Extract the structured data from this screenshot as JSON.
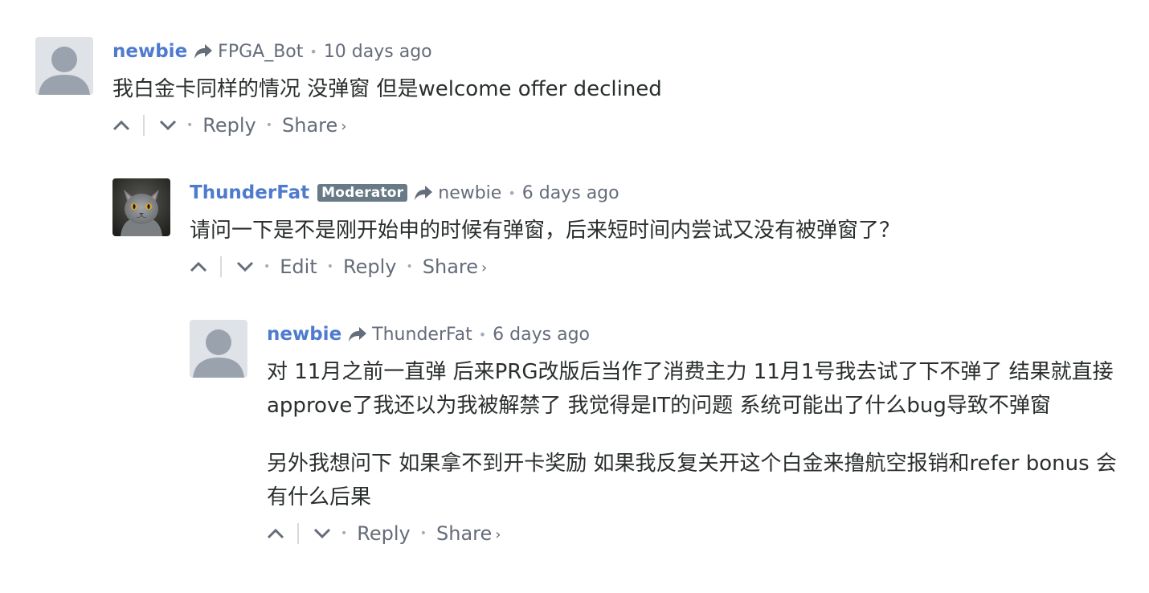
{
  "comments": [
    {
      "author": "newbie",
      "parent": "FPGA_Bot",
      "time": "10 days ago",
      "paragraphs": [
        "我白金卡同样的情况 没弹窗 但是welcome offer declined"
      ],
      "actions": {
        "reply": "Reply",
        "share": "Share"
      }
    },
    {
      "author": "ThunderFat",
      "badge": "Moderator",
      "parent": "newbie",
      "time": "6 days ago",
      "paragraphs": [
        "请问一下是不是刚开始申的时候有弹窗，后来短时间内尝试又没有被弹窗了？"
      ],
      "actions": {
        "edit": "Edit",
        "reply": "Reply",
        "share": "Share"
      }
    },
    {
      "author": "newbie",
      "parent": "ThunderFat",
      "time": "6 days ago",
      "paragraphs": [
        "对 11月之前一直弹 后来PRG改版后当作了消费主力 11月1号我去试了下不弹了 结果就直接approve了我还以为我被解禁了 我觉得是IT的问题 系统可能出了什么bug导致不弹窗",
        "另外我想问下 如果拿不到开卡奖励 如果我反复关开这个白金来撸航空报销和refer bonus 会有什么后果"
      ],
      "actions": {
        "reply": "Reply",
        "share": "Share"
      }
    }
  ],
  "separators": {
    "dot": "•",
    "chevron": "›"
  },
  "icons": {
    "reply_arrow": "reply-arrow-icon",
    "upvote": "chevron-up-icon",
    "downvote": "chevron-down-icon",
    "default_avatar": "user-silhouette-icon",
    "cat_avatar": "cat-avatar-image"
  },
  "colors": {
    "author": "#4f7bcf",
    "meta": "#656c7a",
    "badge_bg": "#687a86",
    "text": "#2a2e2e",
    "avatar_bg": "#dfe3e8",
    "avatar_fg": "#9aa3ad"
  }
}
